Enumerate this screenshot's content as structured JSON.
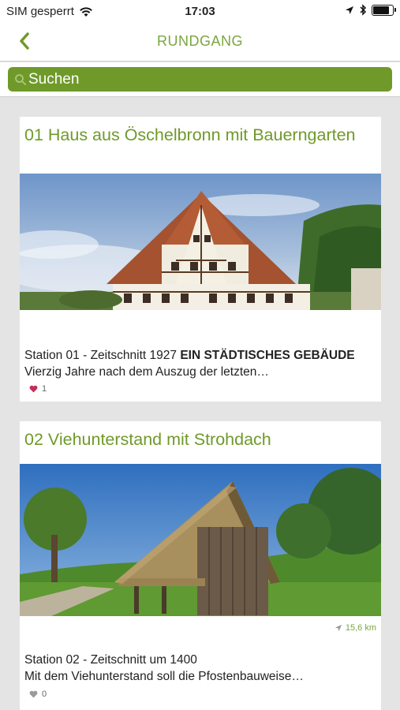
{
  "status": {
    "carrier": "SIM gesperrt",
    "time": "17:03",
    "battery_level": 0.85
  },
  "nav": {
    "back_icon": "chevron-left-icon",
    "title": "RUNDGANG"
  },
  "search": {
    "placeholder": "Suchen",
    "icon": "search-icon"
  },
  "colors": {
    "accent": "#6f9a2a",
    "title_green": "#7aa63d",
    "heart": "#c0305a"
  },
  "stations": [
    {
      "title": "01 Haus aus Öschelbronn mit Bauerngarten",
      "desc_prefix": "Station 01 - Zeitschnitt 1927 ",
      "desc_bold": "EIN STÄDTISCHES GEBÄUDE",
      "desc_suffix": " Vierzig Jahre nach dem Auszug der letzten…",
      "likes": "1",
      "liked": true,
      "image": "half-timbered house photo"
    },
    {
      "title": "02 Viehunterstand mit Strohdach",
      "distance": "15,6 km",
      "desc_line1": "Station 02 - Zeitschnitt um 1400",
      "desc_line2": "Mit dem Viehunterstand soll die Pfostenbauweise…",
      "likes": "0",
      "liked": false,
      "image": "thatched cattle shelter photo"
    }
  ]
}
